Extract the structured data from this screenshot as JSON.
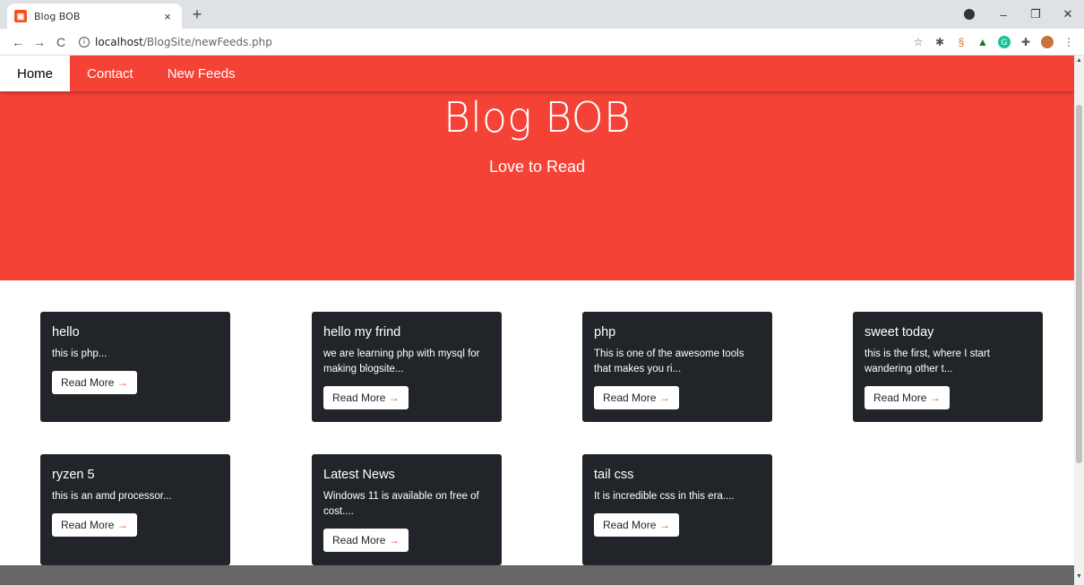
{
  "browser": {
    "tab_title": "Blog BOB",
    "tab_close": "×",
    "new_tab": "+",
    "url_host": "localhost",
    "url_path": "/BlogSite/newFeeds.php"
  },
  "nav": {
    "items": [
      {
        "label": "Home"
      },
      {
        "label": "Contact"
      },
      {
        "label": "New Feeds"
      }
    ]
  },
  "hero": {
    "title": "Blog BOB",
    "subtitle": "Love to Read"
  },
  "cards": [
    {
      "title": "hello",
      "text": "this is php...",
      "button": "Read More"
    },
    {
      "title": "hello my frind",
      "text": "we are learning php with mysql for making blogsite...",
      "button": "Read More"
    },
    {
      "title": "php",
      "text": "This is one of the awesome tools that makes you ri...",
      "button": "Read More"
    },
    {
      "title": "sweet today",
      "text": "this is the first, where I start wandering other t...",
      "button": "Read More"
    },
    {
      "title": "ryzen 5",
      "text": "this is an amd processor...",
      "button": "Read More"
    },
    {
      "title": "Latest News",
      "text": "Windows 11 is available on free of cost....",
      "button": "Read More"
    },
    {
      "title": "tail css",
      "text": "It is incredible css in this era....",
      "button": "Read More"
    }
  ],
  "arrow": "→",
  "colors": {
    "primary": "#f44336",
    "card_bg": "#212529"
  }
}
